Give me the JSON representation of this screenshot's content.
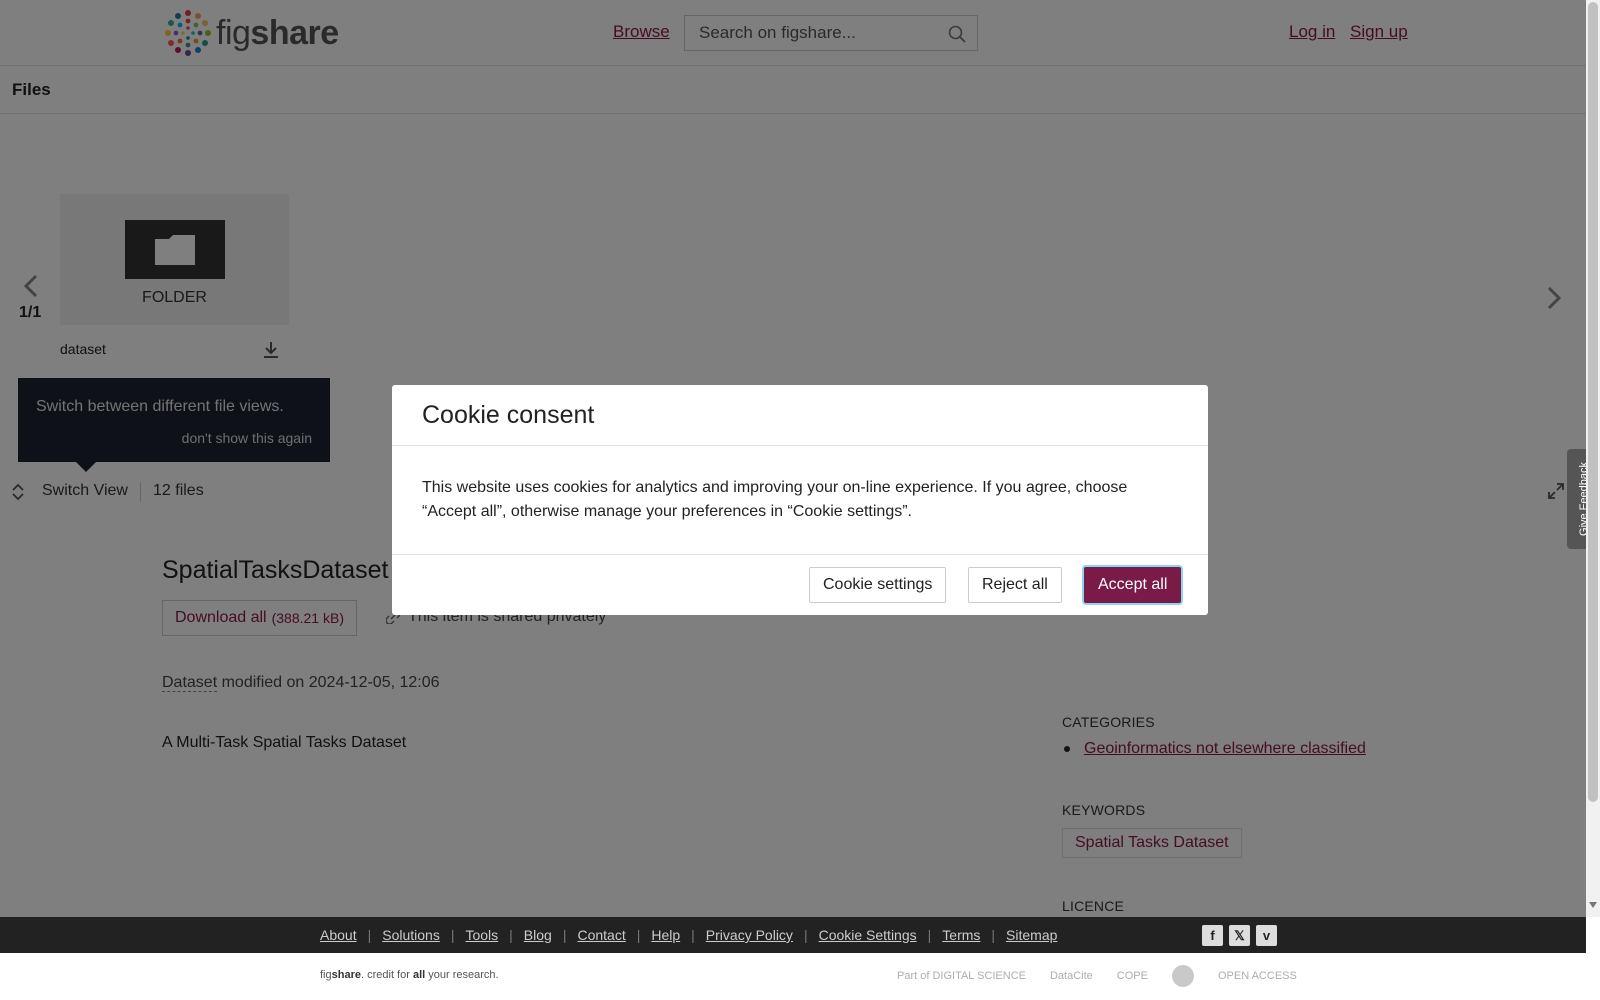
{
  "header": {
    "logo_text_light": "fig",
    "logo_text_bold": "share",
    "browse_label": "Browse",
    "search_placeholder": "Search on figshare...",
    "login_label": "Log in",
    "signup_label": "Sign up"
  },
  "files_section": {
    "title": "Files",
    "counter": "1/1",
    "thumb_type": "FOLDER",
    "file_name": "dataset",
    "tooltip_text": "Switch between different file views.",
    "tooltip_dismiss": "don't show this again",
    "switch_view_label": "Switch View",
    "files_count": "12 files"
  },
  "item": {
    "title": "SpatialTasksDataset",
    "download_label": "Download all",
    "download_size": "(388.21 kB)",
    "shared_text": "This item is shared privately",
    "type_label": "Dataset",
    "modified_text": " modified on 2024-12-05, 12:06",
    "description": "A Multi-Task Spatial Tasks Dataset"
  },
  "sidebar": {
    "categories_heading": "CATEGORIES",
    "categories": [
      "Geoinformatics not elsewhere classified"
    ],
    "keywords_heading": "KEYWORDS",
    "keywords": [
      "Spatial Tasks Dataset"
    ],
    "licence_heading": "LICENCE"
  },
  "cookie_modal": {
    "title": "Cookie consent",
    "body": "This website uses cookies for analytics and improving your on-line experience. If you agree, choose “Accept all”, otherwise manage your preferences in “Cookie settings”.",
    "settings_label": "Cookie settings",
    "reject_label": "Reject all",
    "accept_label": "Accept all"
  },
  "feedback_label": "Give Feedback",
  "footer": {
    "links": [
      "About",
      "Solutions",
      "Tools",
      "Blog",
      "Contact",
      "Help",
      "Privacy Policy",
      "Cookie Settings",
      "Terms",
      "Sitemap"
    ],
    "credit_brand_light": "fig",
    "credit_brand_bold": "share",
    "credit_mid": ". credit for ",
    "credit_bold": "all",
    "credit_end": " your research.",
    "partners": [
      "Part of DIGITAL SCIENCE",
      "DataCite",
      "COPE",
      "OPEN ACCESS"
    ],
    "social_icons": [
      "facebook-icon",
      "x-icon",
      "vimeo-icon"
    ]
  },
  "colors": {
    "accent": "#8b1a4a",
    "accept_button": "#7a1a47",
    "tooltip_bg": "#1d2530",
    "footer_bg": "#222222",
    "overlay": "rgba(0,0,0,0.5)"
  }
}
